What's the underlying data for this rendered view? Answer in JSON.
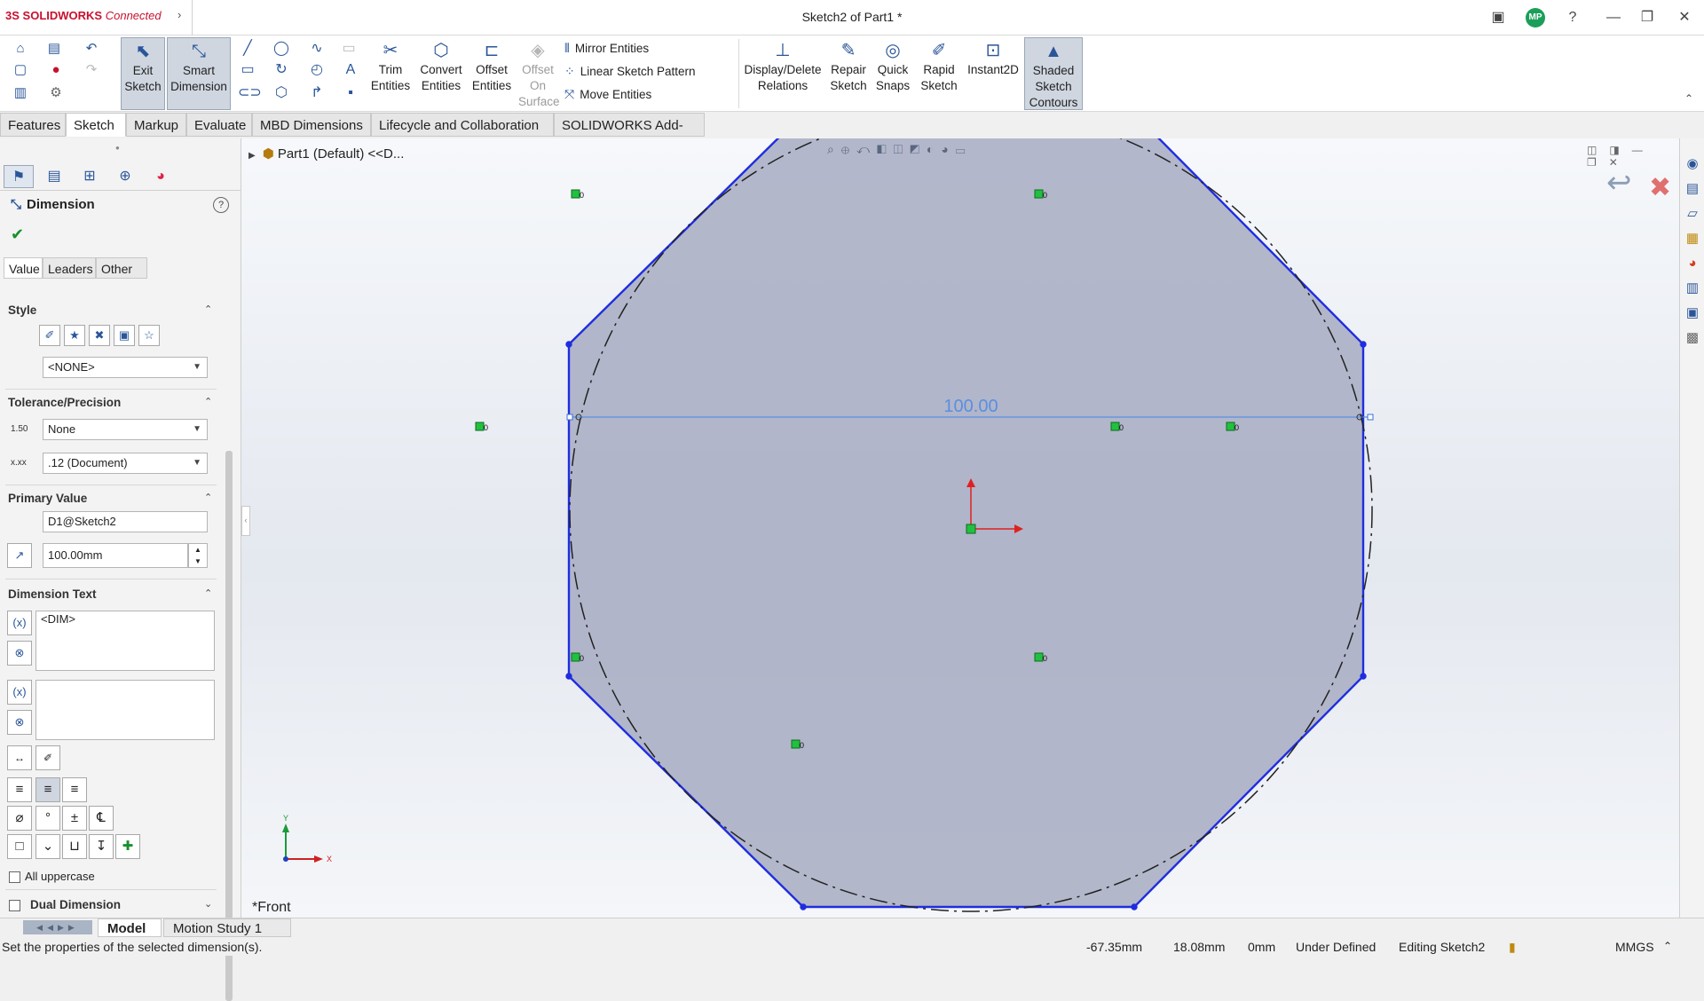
{
  "titlebar": {
    "app_brand": "SOLIDWORKS",
    "app_brand_sub": "Connected",
    "document_title": "Sketch2 of Part1 *",
    "avatar_initials": "MP"
  },
  "commands": {
    "exit_sketch": [
      "Exit",
      "Sketch"
    ],
    "smart_dimension": [
      "Smart",
      "Dimension"
    ],
    "trim_entities": [
      "Trim",
      "Entities"
    ],
    "convert_entities": [
      "Convert",
      "Entities"
    ],
    "offset_entities": [
      "Offset",
      "Entities"
    ],
    "offset_on_surface": [
      "Offset",
      "On",
      "Surface"
    ],
    "mirror_entities": "Mirror Entities",
    "linear_sketch_pattern": "Linear Sketch Pattern",
    "move_entities": "Move Entities",
    "display_delete_relations": [
      "Display/Delete",
      "Relations"
    ],
    "repair_sketch": [
      "Repair",
      "Sketch"
    ],
    "quick_snaps": [
      "Quick",
      "Snaps"
    ],
    "rapid_sketch": [
      "Rapid",
      "Sketch"
    ],
    "instant2d": "Instant2D",
    "shaded_sketch_contours": [
      "Shaded",
      "Sketch",
      "Contours"
    ]
  },
  "tabs": [
    "Features",
    "Sketch",
    "Markup",
    "Evaluate",
    "MBD Dimensions",
    "Lifecycle and Collaboration",
    "SOLIDWORKS Add-Ins"
  ],
  "selected_tab": "Sketch",
  "property_manager": {
    "title": "Dimension",
    "subtabs": [
      "Value",
      "Leaders",
      "Other"
    ],
    "style": {
      "title": "Style",
      "dropdown_value": "<NONE>"
    },
    "tolerance": {
      "title": "Tolerance/Precision",
      "tolerance_type": "None",
      "precision": ".12 (Document)",
      "tol_icon_text": "1.50",
      "prec_icon_text": "x.xx"
    },
    "primary_value": {
      "title": "Primary Value",
      "name": "D1@Sketch2",
      "value": "100.00mm"
    },
    "dimension_text": {
      "title": "Dimension Text",
      "text": "<DIM>"
    },
    "all_uppercase_label": "All uppercase",
    "dual_dimension_label": "Dual Dimension"
  },
  "graphics": {
    "tree_item": "Part1 (Default) <<D...",
    "view_label": "*Front",
    "dimension_value": "100.00",
    "relation_labels": [
      "0",
      "0",
      "0",
      "0",
      "0",
      "0",
      "0",
      "0"
    ],
    "axis_y_label": "Y",
    "axis_x_label": "X",
    "sketch_color": "#1f2de0",
    "fill_color": "#a7abc2"
  },
  "bottom_tabs": [
    "Model",
    "Motion Study 1"
  ],
  "selected_bottom_tab": "Model",
  "status": {
    "message": "Set the properties of the selected dimension(s).",
    "x": "-67.35mm",
    "y": "18.08mm",
    "z": "0mm",
    "state": "Under Defined",
    "editing": "Editing Sketch2",
    "units": "MMGS"
  }
}
